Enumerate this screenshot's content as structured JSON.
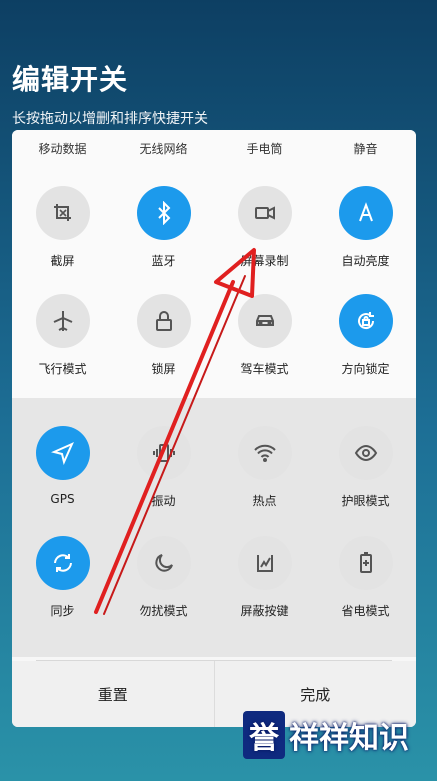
{
  "header": {
    "title": "编辑开关",
    "subtitle": "长按拖动以增删和排序快捷开关"
  },
  "top_row_labels": [
    "移动数据",
    "无线网络",
    "手电筒",
    "静音"
  ],
  "active_rows": [
    [
      {
        "label": "截屏",
        "icon": "screenshot-icon",
        "active": false
      },
      {
        "label": "蓝牙",
        "icon": "bluetooth-icon",
        "active": true
      },
      {
        "label": "屏幕录制",
        "icon": "screen-record-icon",
        "active": false
      },
      {
        "label": "自动亮度",
        "icon": "auto-brightness-icon",
        "active": true
      }
    ],
    [
      {
        "label": "飞行模式",
        "icon": "airplane-icon",
        "active": false
      },
      {
        "label": "锁屏",
        "icon": "lock-icon",
        "active": false
      },
      {
        "label": "驾车模式",
        "icon": "car-icon",
        "active": false
      },
      {
        "label": "方向锁定",
        "icon": "rotation-lock-icon",
        "active": true
      }
    ]
  ],
  "lower_rows": [
    [
      {
        "label": "GPS",
        "icon": "location-icon",
        "active": true
      },
      {
        "label": "振动",
        "icon": "vibrate-icon",
        "active": false
      },
      {
        "label": "热点",
        "icon": "hotspot-icon",
        "active": false
      },
      {
        "label": "护眼模式",
        "icon": "eye-icon",
        "active": false
      }
    ],
    [
      {
        "label": "同步",
        "icon": "sync-icon",
        "active": true
      },
      {
        "label": "勿扰模式",
        "icon": "moon-icon",
        "active": false
      },
      {
        "label": "屏蔽按键",
        "icon": "block-keys-icon",
        "active": false
      },
      {
        "label": "省电模式",
        "icon": "battery-icon",
        "active": false
      }
    ]
  ],
  "footer": {
    "reset_label": "重置",
    "done_label": "完成"
  },
  "watermark": {
    "badge": "誉",
    "text": "祥祥知识"
  },
  "colors": {
    "active": "#1c9aec",
    "inactive": "#e3e3e3",
    "annotation_arrow": "#e02020"
  }
}
